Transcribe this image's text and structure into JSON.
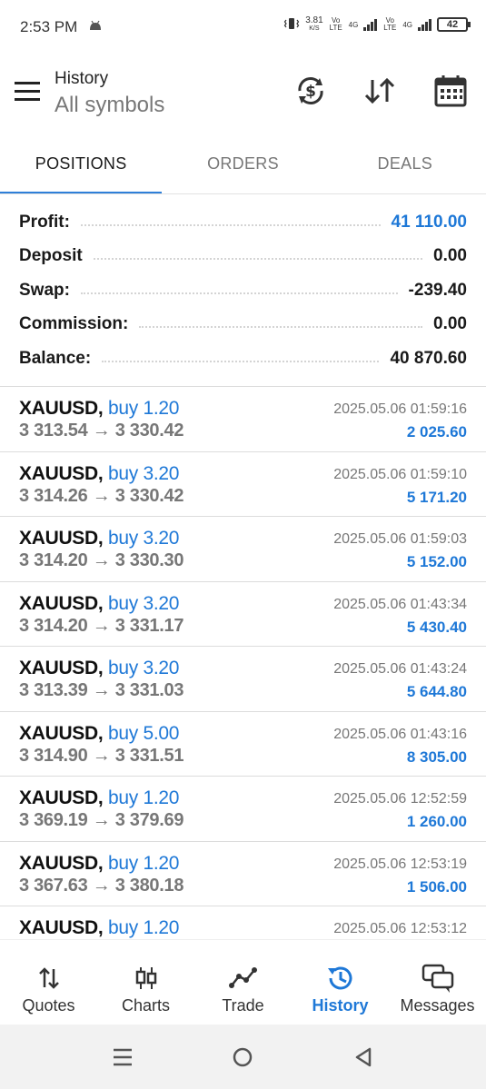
{
  "status_bar": {
    "time": "2:53 PM",
    "net_speed": "3.81",
    "net_unit": "K/S",
    "volte1": "Vo LTE",
    "lte1": "4G",
    "volte2": "Vo LTE",
    "lte2": "4G",
    "battery": "42"
  },
  "header": {
    "title": "History",
    "subtitle": "All symbols",
    "icons": [
      "menu-icon",
      "currency-sync-icon",
      "sort-icon",
      "calendar-icon"
    ]
  },
  "tabs": [
    {
      "label": "POSITIONS",
      "active": true
    },
    {
      "label": "ORDERS",
      "active": false
    },
    {
      "label": "DEALS",
      "active": false
    }
  ],
  "summary": [
    {
      "label": "Profit:",
      "value": "41 110.00",
      "highlight": true
    },
    {
      "label": "Deposit",
      "value": "0.00",
      "highlight": false
    },
    {
      "label": "Swap:",
      "value": "-239.40",
      "highlight": false
    },
    {
      "label": "Commission:",
      "value": "0.00",
      "highlight": false
    },
    {
      "label": "Balance:",
      "value": "40 870.60",
      "highlight": false
    }
  ],
  "deals": [
    {
      "symbol": "XAUUSD,",
      "direction": "buy 1.20",
      "open": "3 313.54",
      "arrow": "→",
      "close": "3 330.42",
      "time": "2025.05.06 01:59:16",
      "profit": "2 025.60"
    },
    {
      "symbol": "XAUUSD,",
      "direction": "buy 3.20",
      "open": "3 314.26",
      "arrow": "→",
      "close": "3 330.42",
      "time": "2025.05.06 01:59:10",
      "profit": "5 171.20"
    },
    {
      "symbol": "XAUUSD,",
      "direction": "buy 3.20",
      "open": "3 314.20",
      "arrow": "→",
      "close": "3 330.30",
      "time": "2025.05.06 01:59:03",
      "profit": "5 152.00"
    },
    {
      "symbol": "XAUUSD,",
      "direction": "buy 3.20",
      "open": "3 314.20",
      "arrow": "→",
      "close": "3 331.17",
      "time": "2025.05.06 01:43:34",
      "profit": "5 430.40"
    },
    {
      "symbol": "XAUUSD,",
      "direction": "buy 3.20",
      "open": "3 313.39",
      "arrow": "→",
      "close": "3 331.03",
      "time": "2025.05.06 01:43:24",
      "profit": "5 644.80"
    },
    {
      "symbol": "XAUUSD,",
      "direction": "buy 5.00",
      "open": "3 314.90",
      "arrow": "→",
      "close": "3 331.51",
      "time": "2025.05.06 01:43:16",
      "profit": "8 305.00"
    },
    {
      "symbol": "XAUUSD,",
      "direction": "buy 1.20",
      "open": "3 369.19",
      "arrow": "→",
      "close": "3 379.69",
      "time": "2025.05.06 12:52:59",
      "profit": "1 260.00"
    },
    {
      "symbol": "XAUUSD,",
      "direction": "buy 1.20",
      "open": "3 367.63",
      "arrow": "→",
      "close": "3 380.18",
      "time": "2025.05.06 12:53:19",
      "profit": "1 506.00"
    },
    {
      "symbol": "XAUUSD,",
      "direction": "buy 1.20",
      "open": "",
      "arrow": "",
      "close": "",
      "time": "2025.05.06 12:53:12",
      "profit": ""
    }
  ],
  "bottom_nav": [
    {
      "label": "Quotes",
      "icon": "quotes-arrows-icon",
      "active": false
    },
    {
      "label": "Charts",
      "icon": "candlestick-icon",
      "active": false
    },
    {
      "label": "Trade",
      "icon": "trade-line-icon",
      "active": false
    },
    {
      "label": "History",
      "icon": "history-clock-icon",
      "active": true
    },
    {
      "label": "Messages",
      "icon": "messages-chat-icon",
      "active": false
    }
  ],
  "colors": {
    "accent": "#1e78d7",
    "tab_underline": "#2e7fd8",
    "muted_text": "#777777",
    "divider": "#dcdcdc"
  }
}
